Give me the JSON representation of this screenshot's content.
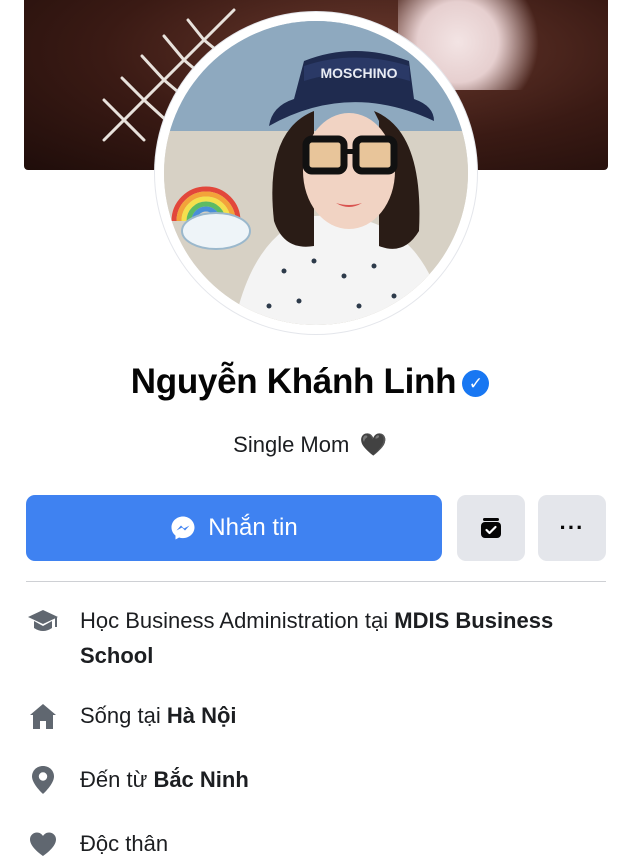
{
  "profile": {
    "name": "Nguyễn Khánh Linh",
    "bio": "Single Mom",
    "bio_emoji": "🖤",
    "avatar_hat_text": "MOSCHINO"
  },
  "actions": {
    "message_label": "Nhắn tin",
    "more_label": "···"
  },
  "intro": {
    "study_prefix": "Học Business Administration tại ",
    "study_school": "MDIS Business School",
    "home_prefix": "Sống tại ",
    "home_city": "Hà Nội",
    "from_prefix": "Đến từ ",
    "from_city": "Bắc Ninh",
    "relationship": "Độc thân"
  },
  "colors": {
    "primary_button": "#3f82f1",
    "verified_badge": "#1877f2",
    "secondary_button": "#e4e6eb",
    "icon_gray": "#606770"
  },
  "icons": {
    "verified": "verified-badge-icon",
    "messenger": "messenger-icon",
    "story_archive": "story-archive-icon",
    "study": "graduation-cap-icon",
    "home": "home-icon",
    "from": "location-pin-icon",
    "relationship": "heart-icon"
  }
}
